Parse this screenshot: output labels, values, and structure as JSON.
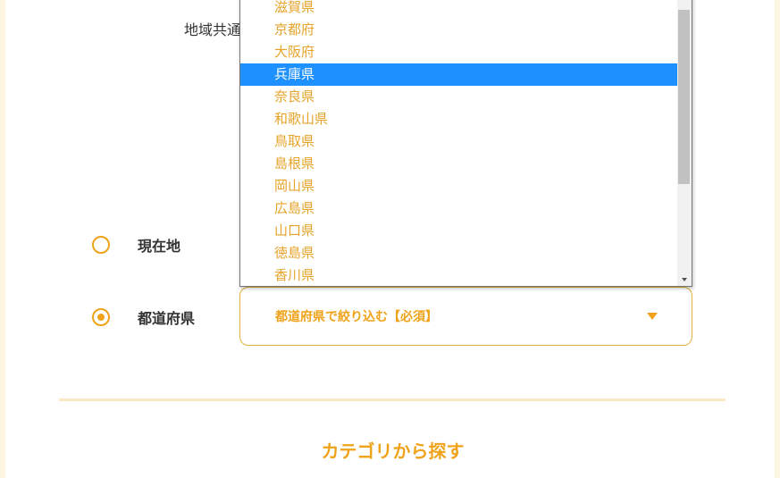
{
  "search": {
    "region_label": "地域共通",
    "options": [
      {
        "label": "現在地",
        "selected": false
      },
      {
        "label": "都道府県",
        "selected": true
      }
    ],
    "prefecture_select": {
      "value": "都道府県で絞り込む【必須】"
    }
  },
  "dropdown": {
    "items": [
      {
        "label": "滋賀県",
        "selected": false
      },
      {
        "label": "京都府",
        "selected": false
      },
      {
        "label": "大阪府",
        "selected": false
      },
      {
        "label": "兵庫県",
        "selected": true
      },
      {
        "label": "奈良県",
        "selected": false
      },
      {
        "label": "和歌山県",
        "selected": false
      },
      {
        "label": "鳥取県",
        "selected": false
      },
      {
        "label": "島根県",
        "selected": false
      },
      {
        "label": "岡山県",
        "selected": false
      },
      {
        "label": "広島県",
        "selected": false
      },
      {
        "label": "山口県",
        "selected": false
      },
      {
        "label": "徳島県",
        "selected": false
      },
      {
        "label": "香川県",
        "selected": false
      }
    ]
  },
  "category": {
    "heading": "カテゴリから探す"
  },
  "colors": {
    "accent": "#f0a31a",
    "selected_highlight": "#1e90ff",
    "divider": "#fbe9c6"
  }
}
